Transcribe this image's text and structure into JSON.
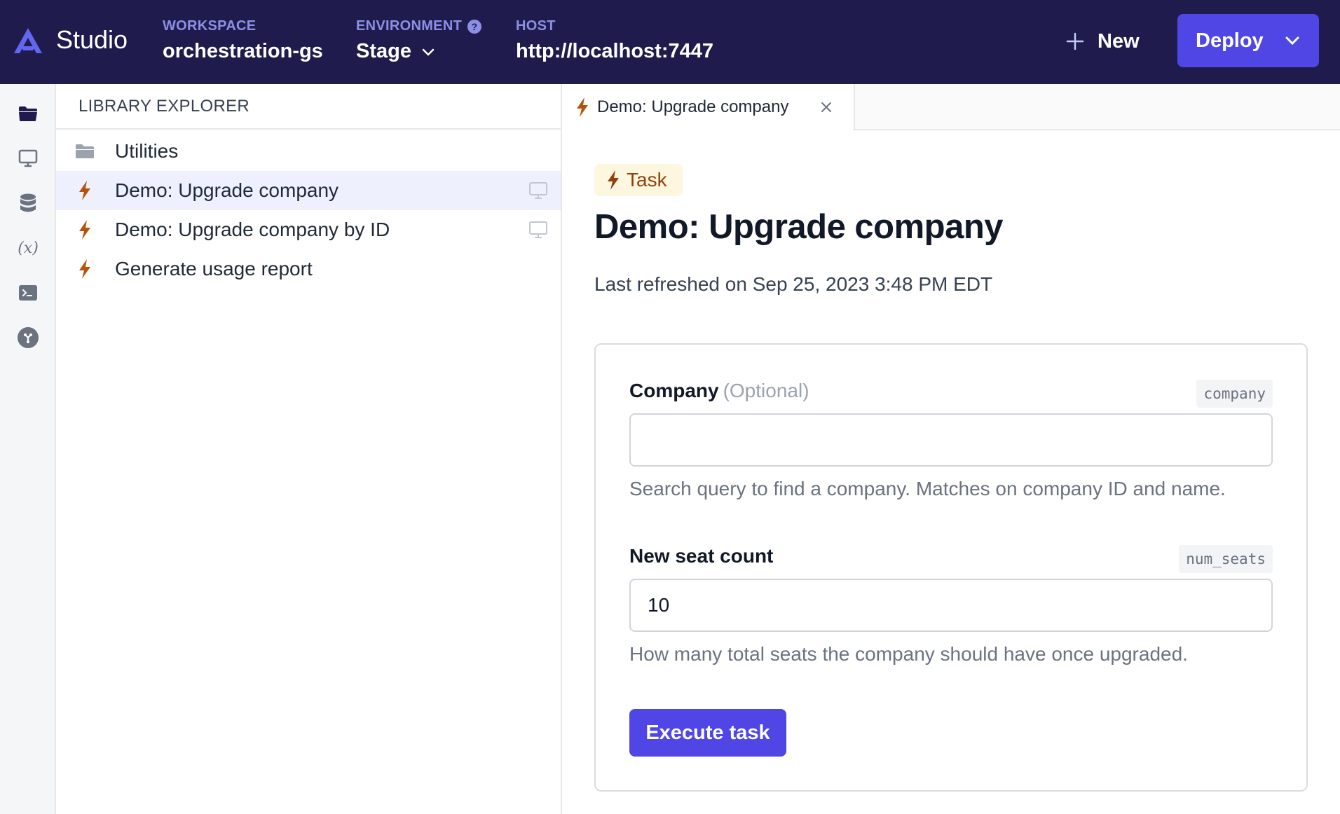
{
  "topbar": {
    "brand": "Studio",
    "workspace": {
      "label": "WORKSPACE",
      "value": "orchestration-gs"
    },
    "environment": {
      "label": "ENVIRONMENT",
      "value": "Stage",
      "help": "?"
    },
    "host": {
      "label": "HOST",
      "value": "http://localhost:7447"
    },
    "new_label": "New",
    "deploy_label": "Deploy"
  },
  "rail": {
    "icons": [
      "folder-icon",
      "monitor-icon",
      "database-icon",
      "variable-icon",
      "terminal-icon",
      "plugin-icon"
    ],
    "variable_glyph": "(x)"
  },
  "explorer": {
    "title": "LIBRARY EXPLORER",
    "items": [
      {
        "label": "Utilities",
        "icon": "folder-icon",
        "selected": false
      },
      {
        "label": "Demo: Upgrade company",
        "icon": "bolt-icon",
        "selected": true
      },
      {
        "label": "Demo: Upgrade company by ID",
        "icon": "bolt-icon",
        "selected": false
      },
      {
        "label": "Generate usage report",
        "icon": "bolt-icon",
        "selected": false
      }
    ]
  },
  "tabs": [
    {
      "label": "Demo: Upgrade company",
      "icon": "bolt-icon"
    }
  ],
  "main": {
    "badge": "Task",
    "title": "Demo: Upgrade company",
    "refreshed": "Last refreshed on Sep 25, 2023 3:48 PM EDT",
    "fields": [
      {
        "label": "Company",
        "optional": "(Optional)",
        "slug": "company",
        "value": "",
        "placeholder": "",
        "help": "Search query to find a company. Matches on company ID and name."
      },
      {
        "label": "New seat count",
        "optional": "",
        "slug": "num_seats",
        "value": "10",
        "placeholder": "",
        "help": "How many total seats the company should have once upgraded."
      }
    ],
    "execute_label": "Execute task"
  },
  "colors": {
    "topbar_bg": "#1f1c4d",
    "accent": "#4f46e5",
    "label_purple": "#8d8fe6",
    "bolt": "#b45309",
    "badge_bg": "#fef7e0",
    "selected_row": "#eef0fd"
  }
}
